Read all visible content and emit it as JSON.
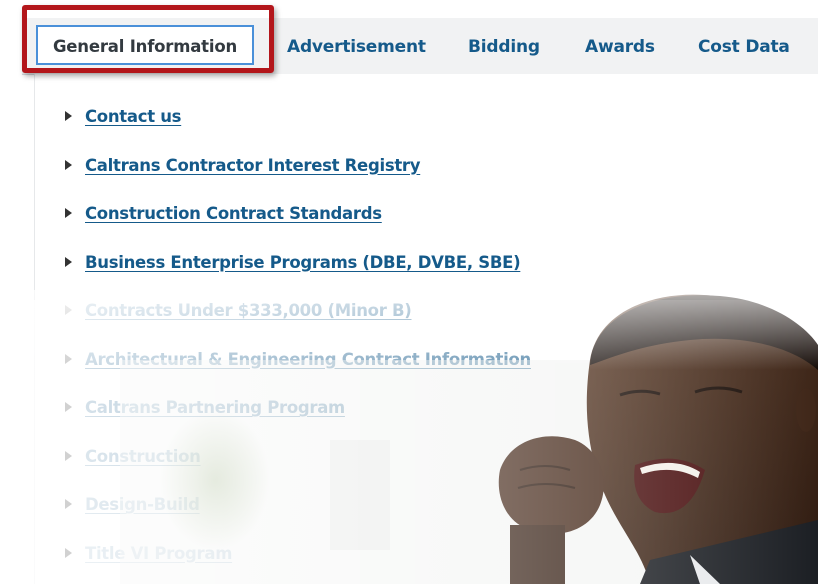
{
  "tabs": [
    {
      "label": "General Information",
      "active": true
    },
    {
      "label": "Advertisement"
    },
    {
      "label": "Bidding"
    },
    {
      "label": "Awards"
    },
    {
      "label": "Cost Data"
    }
  ],
  "links": [
    {
      "label": "Contact us"
    },
    {
      "label": "Caltrans Contractor Interest Registry"
    },
    {
      "label": "Construction Contract Standards"
    },
    {
      "label": "Business Enterprise Programs (DBE, DVBE, SBE)"
    },
    {
      "label": "Contracts Under $333,000 (Minor B)"
    },
    {
      "label": "Architectural & Engineering Contract Information"
    },
    {
      "label": "Caltrans Partnering Program"
    },
    {
      "label": "Construction"
    },
    {
      "label": "Design-Build"
    },
    {
      "label": "Title VI Program"
    }
  ],
  "colors": {
    "link": "#155a8a",
    "tab_active_border": "#4a90d9",
    "highlight": "#b3161b",
    "tabbar_bg": "#f1f2f3"
  }
}
